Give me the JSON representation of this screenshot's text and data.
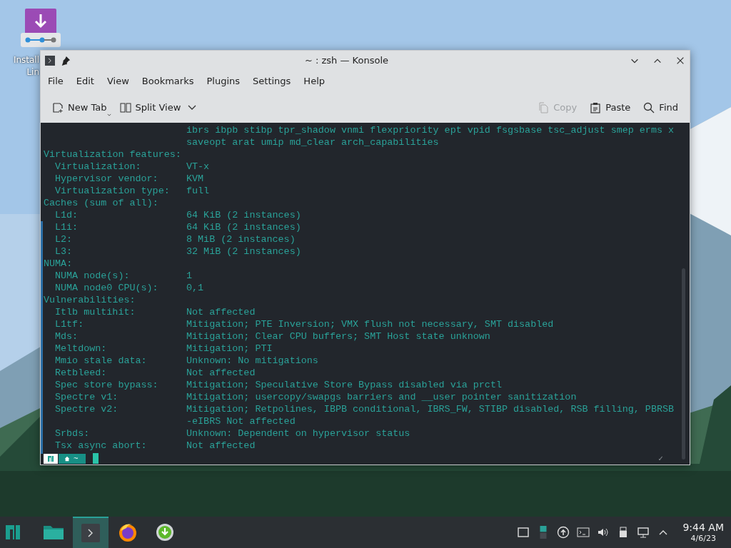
{
  "desktop_icon": {
    "label_lines": [
      "Install",
      "Lin"
    ]
  },
  "window": {
    "title": "~ : zsh — Konsole"
  },
  "menu": [
    "File",
    "Edit",
    "View",
    "Bookmarks",
    "Plugins",
    "Settings",
    "Help"
  ],
  "toolbar": [
    {
      "kind": "new-tab",
      "label": "New Tab",
      "disabled": false
    },
    {
      "kind": "split",
      "label": "Split View",
      "disabled": false
    },
    {
      "kind": "copy",
      "label": "Copy",
      "disabled": true
    },
    {
      "kind": "paste",
      "label": "Paste",
      "disabled": false
    },
    {
      "kind": "find",
      "label": "Find",
      "disabled": false
    }
  ],
  "terminal": {
    "lines": [
      {
        "kind": "wrap",
        "value": "ibrs ibpb stibp tpr_shadow vnmi flexpriority ept vpid fsgsbase tsc_adjust smep erms x"
      },
      {
        "kind": "wrap",
        "value": "saveopt arat umip md_clear arch_capabilities"
      },
      {
        "kind": "section",
        "label": "Virtualization features:"
      },
      {
        "kind": "field",
        "label": "Virtualization:",
        "value": "VT-x"
      },
      {
        "kind": "field",
        "label": "Hypervisor vendor:",
        "value": "KVM"
      },
      {
        "kind": "field",
        "label": "Virtualization type:",
        "value": "full"
      },
      {
        "kind": "section",
        "label": "Caches (sum of all):"
      },
      {
        "kind": "field",
        "label": "L1d:",
        "value": "64 KiB (2 instances)"
      },
      {
        "kind": "field",
        "label": "L1i:",
        "value": "64 KiB (2 instances)"
      },
      {
        "kind": "field",
        "label": "L2:",
        "value": "8 MiB (2 instances)"
      },
      {
        "kind": "field",
        "label": "L3:",
        "value": "32 MiB (2 instances)"
      },
      {
        "kind": "section",
        "label": "NUMA:"
      },
      {
        "kind": "field",
        "label": "NUMA node(s):",
        "value": "1"
      },
      {
        "kind": "field",
        "label": "NUMA node0 CPU(s):",
        "value": "0,1"
      },
      {
        "kind": "section",
        "label": "Vulnerabilities:"
      },
      {
        "kind": "field",
        "label": "Itlb multihit:",
        "value": "Not affected"
      },
      {
        "kind": "field",
        "label": "L1tf:",
        "value": "Mitigation; PTE Inversion; VMX flush not necessary, SMT disabled"
      },
      {
        "kind": "field",
        "label": "Mds:",
        "value": "Mitigation; Clear CPU buffers; SMT Host state unknown"
      },
      {
        "kind": "field",
        "label": "Meltdown:",
        "value": "Mitigation; PTI"
      },
      {
        "kind": "field",
        "label": "Mmio stale data:",
        "value": "Unknown: No mitigations"
      },
      {
        "kind": "field",
        "label": "Retbleed:",
        "value": "Not affected"
      },
      {
        "kind": "field",
        "label": "Spec store bypass:",
        "value": "Mitigation; Speculative Store Bypass disabled via prctl"
      },
      {
        "kind": "field",
        "label": "Spectre v1:",
        "value": "Mitigation; usercopy/swapgs barriers and __user pointer sanitization"
      },
      {
        "kind": "field",
        "label": "Spectre v2:",
        "value": "Mitigation; Retpolines, IBPB conditional, IBRS_FW, STIBP disabled, RSB filling, PBRSB"
      },
      {
        "kind": "wrap",
        "value": "-eIBRS Not affected"
      },
      {
        "kind": "field",
        "label": "Srbds:",
        "value": "Unknown: Dependent on hypervisor status"
      },
      {
        "kind": "field",
        "label": "Tsx async abort:",
        "value": "Not affected"
      }
    ],
    "prompt": {
      "dir": "~",
      "status": "✓"
    }
  },
  "taskbar": {
    "tasks": [
      {
        "kind": "files",
        "selected": false
      },
      {
        "kind": "terminal",
        "selected": true
      },
      {
        "kind": "browser",
        "selected": false
      },
      {
        "kind": "installer",
        "selected": false
      }
    ],
    "clock": {
      "time": "9:44 AM",
      "date": "4/6/23"
    }
  }
}
